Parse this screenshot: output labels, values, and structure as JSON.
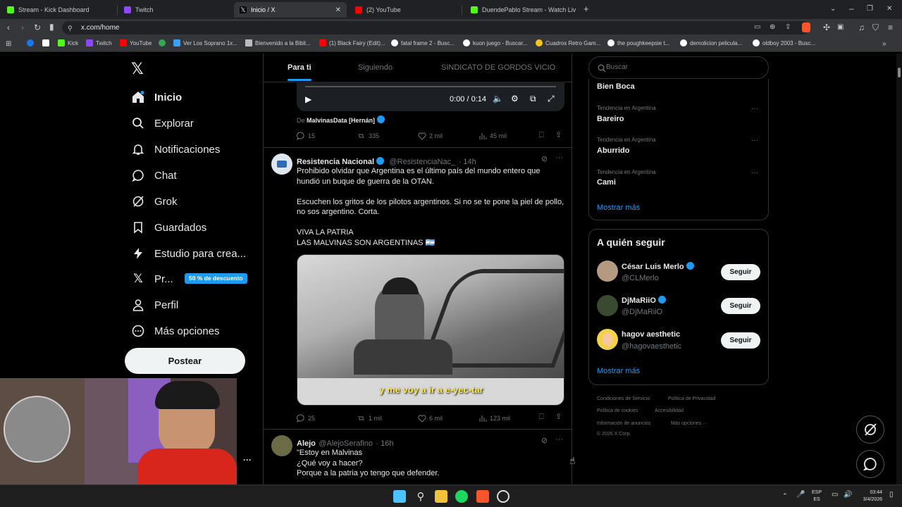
{
  "browser": {
    "tabs": [
      {
        "label": "Stream - Kick Dashboard",
        "color": "#53fc18"
      },
      {
        "label": "Twitch",
        "color": "#9146ff"
      },
      {
        "label": "Inicio / X",
        "color": "#ffffff",
        "active": true
      },
      {
        "label": "(2) YouTube",
        "color": "#ff0000"
      },
      {
        "label": "DuendePablo Stream - Watch Liv",
        "color": "#53fc18"
      }
    ],
    "url": "x.com/home",
    "bookmarks": [
      {
        "label": "",
        "color": "#1877f2"
      },
      {
        "label": "",
        "color": "#ffffff"
      },
      {
        "label": "Kick",
        "color": "#53fc18"
      },
      {
        "label": "Twitch",
        "color": "#9146ff"
      },
      {
        "label": "YouTube",
        "color": "#ff0000"
      },
      {
        "label": "",
        "color": "#34a853"
      },
      {
        "label": "Ver Los Soprano 1x...",
        "color": "#3aa0ff"
      },
      {
        "label": "Bienvenido a la Bibli...",
        "color": "#bbbbbb"
      },
      {
        "label": "(1) Black Fairy (Edit)...",
        "color": "#ff0000"
      },
      {
        "label": "fatal frame 2 - Busc...",
        "color": "#ffffff"
      },
      {
        "label": "kuon juego - Buscar...",
        "color": "#ffffff"
      },
      {
        "label": "Cuadros Retro Gam...",
        "color": "#f5c518"
      },
      {
        "label": "the poughkeepsie t...",
        "color": "#ffffff"
      },
      {
        "label": "demolicion pelicula...",
        "color": "#ffffff"
      },
      {
        "label": "oldboy 2003 - Busc...",
        "color": "#ffffff"
      }
    ]
  },
  "nav": {
    "items": [
      {
        "label": "Inicio",
        "icon": "home-icon"
      },
      {
        "label": "Explorar",
        "icon": "search-icon"
      },
      {
        "label": "Notificaciones",
        "icon": "bell-icon"
      },
      {
        "label": "Chat",
        "icon": "chat-icon"
      },
      {
        "label": "Grok",
        "icon": "grok-icon"
      },
      {
        "label": "Guardados",
        "icon": "bookmark-icon"
      },
      {
        "label": "Estudio para crea...",
        "icon": "lightning-icon"
      },
      {
        "label": "Pr...",
        "icon": "x-logo-icon"
      },
      {
        "label": "Perfil",
        "icon": "person-icon"
      },
      {
        "label": "Más opciones",
        "icon": "more-circle-icon"
      }
    ],
    "premium_badge": "50 % de descuento",
    "post_label": "Postear"
  },
  "feed": {
    "tabs": [
      "Para ti",
      "Siguiendo",
      "SINDICATO DE GORDOS VICIO"
    ],
    "video_time": "0:00 / 0:14",
    "source_prefix": "De",
    "source_name": "MalvinasData [Hernán]",
    "post1_stats": {
      "replies": "15",
      "reposts": "335",
      "likes": "2 mil",
      "views": "45 mil"
    },
    "tweet2": {
      "name": "Resistencia Nacional",
      "handle": "@ResistenciaNac_",
      "time": "· 14h",
      "text": "Prohibido olvidar que Argentina es el último país del mundo entero que hundió un buque de guerra de la OTAN.\n\nEscuchen los gritos de los pilotos argentinos. Si no se te pone la piel de pollo, no sos argentino. Corta.\n\nVIVA LA PATRIA\nLAS MALVINAS SON ARGENTINAS 🇦🇷",
      "caption": "y me voy a ir a e-yec-tar",
      "stats": {
        "replies": "25",
        "reposts": "1 mil",
        "likes": "6 mil",
        "views": "123 mil"
      }
    },
    "tweet3": {
      "name": "Alejo",
      "handle": "@AlejoSerafino",
      "time": "· 16h",
      "text": "\"Estoy en Malvinas\n¿Qué voy a hacer?\nPorque a la patria yo tengo que defender."
    }
  },
  "sidebar": {
    "search_placeholder": "Buscar",
    "top_trend": "Bien Boca",
    "trends": [
      {
        "label": "Tendencia en Argentina",
        "name": "Bareiro"
      },
      {
        "label": "Tendencia en Argentina",
        "name": "Aburrido"
      },
      {
        "label": "Tendencia en Argentina",
        "name": "Cami"
      }
    ],
    "show_more": "Mostrar más",
    "who_to_follow_title": "A quién seguir",
    "suggestions": [
      {
        "name": "César Luis Merlo",
        "handle": "@CLMerlo",
        "verified": true
      },
      {
        "name": "DjMaRiiO",
        "handle": "@DjMaRiiO",
        "verified": true
      },
      {
        "name": "hagov aesthetic",
        "handle": "@hagovaesthetic",
        "verified": false
      }
    ],
    "follow_label": "Seguir",
    "show_more_2": "Mostrar más",
    "footer": {
      "terms": "Condiciones de Servicio",
      "privacy": "Política de Privacidad",
      "cookies": "Política de cookies",
      "accessibility": "Accesibilidad",
      "ads": "Información de anuncios",
      "more": "Más opciones ···",
      "copyright": "© 2026 X Corp."
    }
  },
  "taskbar": {
    "lang_top": "ESP",
    "lang_bottom": "ES",
    "time": "03:44",
    "date": "3/4/2026"
  }
}
